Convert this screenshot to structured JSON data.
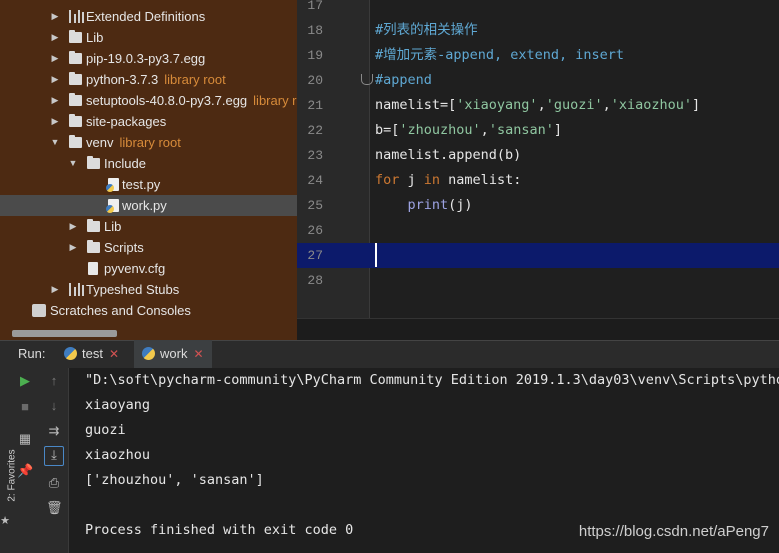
{
  "project_tree": {
    "items": [
      {
        "label": "Extended Definitions",
        "suffix": ""
      },
      {
        "label": "Lib",
        "suffix": ""
      },
      {
        "label": "pip-19.0.3-py3.7.egg",
        "suffix": ""
      },
      {
        "label": "python-3.7.3",
        "suffix": "library root"
      },
      {
        "label": "setuptools-40.8.0-py3.7.egg",
        "suffix": "library r"
      },
      {
        "label": "site-packages",
        "suffix": ""
      },
      {
        "label": "venv",
        "suffix": "library root"
      },
      {
        "label": "Include",
        "suffix": ""
      },
      {
        "label": "test.py",
        "suffix": ""
      },
      {
        "label": "work.py",
        "suffix": ""
      },
      {
        "label": "Lib",
        "suffix": ""
      },
      {
        "label": "Scripts",
        "suffix": ""
      },
      {
        "label": "pyvenv.cfg",
        "suffix": ""
      },
      {
        "label": "Typeshed Stubs",
        "suffix": ""
      },
      {
        "label": "Scratches and Consoles",
        "suffix": ""
      }
    ]
  },
  "editor": {
    "line_numbers": [
      "17",
      "18",
      "19",
      "20",
      "21",
      "22",
      "23",
      "24",
      "25",
      "26",
      "27",
      "28"
    ],
    "lines": {
      "l18": "#列表的相关操作",
      "l19": "#增加元素-append, extend, insert",
      "l20": "#append",
      "l21_a": "namelist=[",
      "l21_s1": "'xiaoyang'",
      "l21_c1": ",",
      "l21_s2": "'guozi'",
      "l21_c2": ",",
      "l21_s3": "'xiaozhou'",
      "l21_e": "]",
      "l22_a": "b=[",
      "l22_s1": "'zhouzhou'",
      "l22_c1": ",",
      "l22_s2": "'sansan'",
      "l22_e": "]",
      "l23": "namelist.append(b)",
      "l24_kw1": "for",
      "l24_a": " j ",
      "l24_kw2": "in",
      "l24_b": " namelist:",
      "l25_indent": "    ",
      "l25_fn": "print",
      "l25_b": "(j)"
    },
    "current_line": "27"
  },
  "run_panel": {
    "label": "Run:",
    "tabs": [
      {
        "label": "test",
        "close": "✕"
      },
      {
        "label": "work",
        "close": "✕"
      }
    ],
    "console_lines": [
      "\"D:\\soft\\pycharm-community\\PyCharm Community Edition 2019.1.3\\day03\\venv\\Scripts\\python",
      "xiaoyang",
      "guozi",
      "xiaozhou",
      "['zhouzhou', 'sansan']",
      "",
      "Process finished with exit code 0"
    ],
    "favorites_label": "2: Favorites"
  },
  "watermark": "https://blog.csdn.net/aPeng7",
  "colors": {
    "tree_bg": "#4d2a12",
    "comment": "#5fa8d3",
    "string": "#8fc6a0",
    "keyword": "#cc7832",
    "builtin": "#9da3e3",
    "current_line": "#0c1a6b",
    "library_root": "#d78b3a"
  }
}
